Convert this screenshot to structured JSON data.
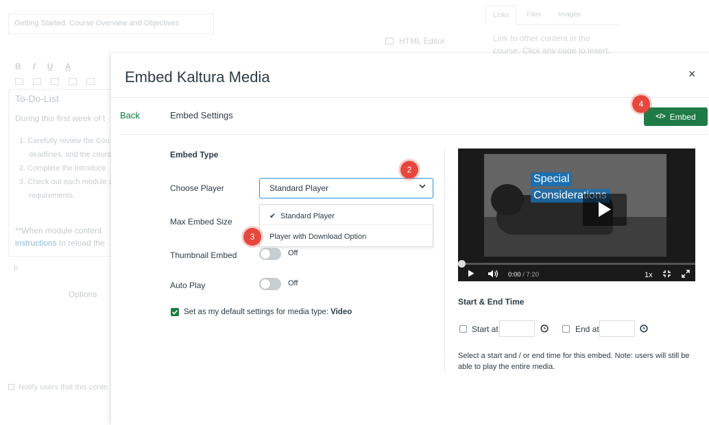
{
  "background": {
    "title_input_value": "Getting Started: Course Overview and Objectives",
    "html_editor_label": "HTML Editor",
    "side_tabs": [
      "Links",
      "Files",
      "Images"
    ],
    "side_text": "Link to other content in the course. Click any page to insert.",
    "toolbar_letters": [
      "B",
      "I",
      "U",
      "A"
    ],
    "todo_heading": "To-Do-List",
    "during_text": "During this first week of t",
    "list_items": [
      "1. Carefully review the Cou",
      "deadlines, and the course",
      "2. Complete the Introduce",
      "3. Check out each module a",
      "requirements."
    ],
    "when_text": "**When module content",
    "instructions_link": "instructions",
    "instructions_rest": " to reload the",
    "p_label": "p",
    "options_label": "Options",
    "notify_text": "Notify users that this conte"
  },
  "modal": {
    "title": "Embed Kaltura Media",
    "close_glyph": "×",
    "back_label": "Back",
    "embed_settings_label": "Embed Settings",
    "embed_button": {
      "code_glyph": "</>",
      "label": "Embed"
    },
    "embed_type_label": "Embed Type",
    "choose_player_label": "Choose Player",
    "selected_player": "Standard Player",
    "player_options": [
      "Standard Player",
      "Player with Download Option"
    ],
    "max_embed_size_label": "Max Embed Size",
    "thumbnail_embed": {
      "label": "Thumbnail Embed",
      "state": "Off"
    },
    "auto_play": {
      "label": "Auto Play",
      "state": "Off"
    },
    "default_settings": {
      "text": "Set as my default settings for media type: ",
      "media_type": "Video",
      "checked": true
    },
    "video": {
      "caption_line1": "Special",
      "caption_line2": "Considerations",
      "current_time": "0:00",
      "duration": "/ 7:20",
      "speed": "1x",
      "progress": 0
    },
    "start_end": {
      "title": "Start & End Time",
      "start_label": "Start at",
      "end_label": "End at",
      "start_value": "",
      "end_value": "",
      "help_text": "Select a start and / or end time for this embed. Note: users will still be able to play the entire media."
    }
  },
  "steps": [
    "2",
    "3",
    "4"
  ],
  "colors": {
    "accent_green": "#1e7b45",
    "select_border": "#2b8fd6",
    "step_red": "#e8473d"
  }
}
